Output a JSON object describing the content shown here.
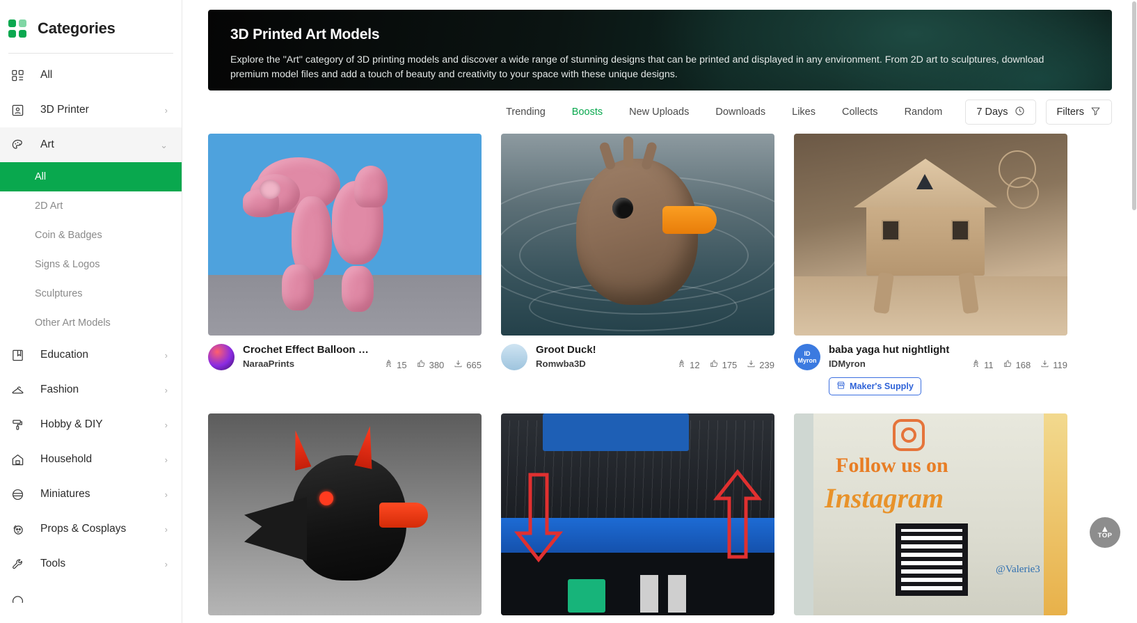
{
  "sidebar": {
    "title": "Categories",
    "logo_icon": "grid-logo-icon",
    "items": [
      {
        "label": "All",
        "icon": "grid-list-icon",
        "chevron": "",
        "expanded": false
      },
      {
        "label": "3D Printer",
        "icon": "printer-icon",
        "chevron": "›",
        "expanded": false
      },
      {
        "label": "Art",
        "icon": "palette-icon",
        "chevron": "⌄",
        "expanded": true
      },
      {
        "label": "Education",
        "icon": "book-icon",
        "chevron": "›",
        "expanded": false
      },
      {
        "label": "Fashion",
        "icon": "hanger-icon",
        "chevron": "›",
        "expanded": false
      },
      {
        "label": "Hobby & DIY",
        "icon": "paint-roller-icon",
        "chevron": "›",
        "expanded": false
      },
      {
        "label": "Household",
        "icon": "house-icon",
        "chevron": "›",
        "expanded": false
      },
      {
        "label": "Miniatures",
        "icon": "miniature-icon",
        "chevron": "›",
        "expanded": false
      },
      {
        "label": "Props & Cosplays",
        "icon": "mask-icon",
        "chevron": "›",
        "expanded": false
      },
      {
        "label": "Tools",
        "icon": "wrench-icon",
        "chevron": "›",
        "expanded": false
      }
    ],
    "art_subitems": [
      {
        "label": "All",
        "active": true
      },
      {
        "label": "2D Art",
        "active": false
      },
      {
        "label": "Coin & Badges",
        "active": false
      },
      {
        "label": "Signs & Logos",
        "active": false
      },
      {
        "label": "Sculptures",
        "active": false
      },
      {
        "label": "Other Art Models",
        "active": false
      }
    ]
  },
  "banner": {
    "title": "3D Printed Art Models",
    "description": "Explore the \"Art\" category of 3D printing models and discover a wide range of stunning designs that can be printed and displayed in any environment. From 2D art to sculptures, download premium model files and add a touch of beauty and creativity to your space with these unique designs."
  },
  "tabs": [
    {
      "label": "Trending",
      "active": false
    },
    {
      "label": "Boosts",
      "active": true
    },
    {
      "label": "New Uploads",
      "active": false
    },
    {
      "label": "Downloads",
      "active": false
    },
    {
      "label": "Likes",
      "active": false
    },
    {
      "label": "Collects",
      "active": false
    },
    {
      "label": "Random",
      "active": false
    }
  ],
  "controls": {
    "time_range_label": "7 Days",
    "time_range_icon": "clock-icon",
    "filters_label": "Filters",
    "filters_icon": "funnel-icon"
  },
  "cards": [
    {
      "title": "Crochet Effect Balloon Dog",
      "author": "NaraaPrints",
      "avatar_text": "",
      "stats": {
        "boosts": "15",
        "likes": "380",
        "downloads": "665"
      },
      "badge": null,
      "image": "crochet-balloon-dog-photo"
    },
    {
      "title": "Groot Duck!",
      "author": "Romwba3D",
      "avatar_text": "",
      "stats": {
        "boosts": "12",
        "likes": "175",
        "downloads": "239"
      },
      "badge": null,
      "image": "groot-duck-photo"
    },
    {
      "title": "baba yaga hut nightlight",
      "author": "IDMyron",
      "avatar_text": "ID Myron",
      "stats": {
        "boosts": "11",
        "likes": "168",
        "downloads": "119"
      },
      "badge": {
        "label": "Maker's Supply",
        "icon": "store-icon"
      },
      "image": "baba-yaga-hut-photo"
    },
    {
      "title": "",
      "author": "",
      "avatar_text": "",
      "stats": {
        "boosts": "",
        "likes": "",
        "downloads": ""
      },
      "badge": null,
      "image": "devil-duck-photo"
    },
    {
      "title": "",
      "author": "",
      "avatar_text": "",
      "stats": {
        "boosts": "",
        "likes": "",
        "downloads": ""
      },
      "badge": null,
      "image": "printer-bed-arrows-photo"
    },
    {
      "title": "",
      "author": "",
      "avatar_text": "",
      "stats": {
        "boosts": "",
        "likes": "",
        "downloads": ""
      },
      "badge": null,
      "image": "instagram-sign-photo"
    }
  ],
  "scroll_top": {
    "label": "TOP",
    "icon": "chevron-up-icon"
  },
  "colors": {
    "accent_green": "#09a84e",
    "badge_blue": "#2f63d8",
    "text_dark": "#1d1d1d",
    "text_muted": "#6d6d6d"
  }
}
